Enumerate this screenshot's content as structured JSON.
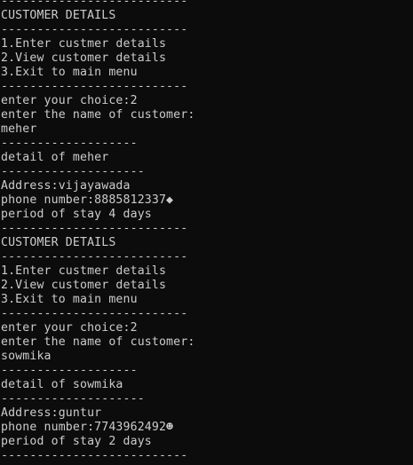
{
  "colors": {
    "background": "#0c0c0c",
    "text": "#cccccc"
  },
  "console": {
    "lines": [
      "--------------------------",
      "CUSTOMER DETAILS",
      "--------------------------",
      "1.Enter custmer details",
      "2.View customer details",
      "3.Exit to main menu",
      "--------------------------",
      "enter your choice:2",
      "enter the name of customer:",
      "meher",
      "-------------------",
      "detail of meher",
      "--------------------",
      "Address:vijayawada",
      "phone number:8885812337◆",
      "period of stay 4 days",
      "--------------------------",
      "CUSTOMER DETAILS",
      "--------------------------",
      "1.Enter custmer details",
      "2.View customer details",
      "3.Exit to main menu",
      "--------------------------",
      "enter your choice:2",
      "enter the name of customer:",
      "sowmika",
      "-------------------",
      "detail of sowmika",
      "--------------------",
      "Address:guntur",
      "phone number:7743962492☻",
      "period of stay 2 days",
      "--------------------------"
    ]
  }
}
